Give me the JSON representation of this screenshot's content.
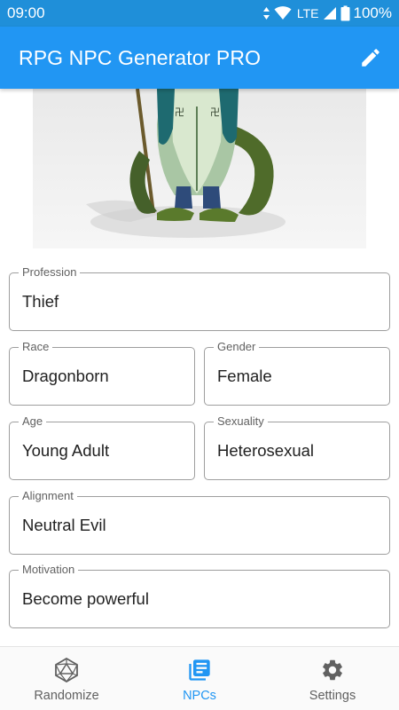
{
  "status_bar": {
    "time": "09:00",
    "network": "LTE",
    "battery": "100%"
  },
  "app_bar": {
    "title": "RPG NPC Generator PRO",
    "action_icon": "pencil-icon"
  },
  "portrait": {
    "alt": "dragonborn-illustration"
  },
  "fields": {
    "profession": {
      "label": "Profession",
      "value": "Thief"
    },
    "race": {
      "label": "Race",
      "value": "Dragonborn"
    },
    "gender": {
      "label": "Gender",
      "value": "Female"
    },
    "age": {
      "label": "Age",
      "value": "Young Adult"
    },
    "sexuality": {
      "label": "Sexuality",
      "value": "Heterosexual"
    },
    "alignment": {
      "label": "Alignment",
      "value": "Neutral Evil"
    },
    "motivation": {
      "label": "Motivation",
      "value": "Become powerful"
    }
  },
  "bottom_nav": {
    "items": [
      {
        "label": "Randomize",
        "icon": "d20-dice-icon",
        "active": false
      },
      {
        "label": "NPCs",
        "icon": "library-books-icon",
        "active": true
      },
      {
        "label": "Settings",
        "icon": "gear-icon",
        "active": false
      }
    ]
  },
  "colors": {
    "primary": "#2196f3",
    "status_bar": "#1f8fd9",
    "active_nav": "#2196f3",
    "inactive_nav": "#616161"
  }
}
